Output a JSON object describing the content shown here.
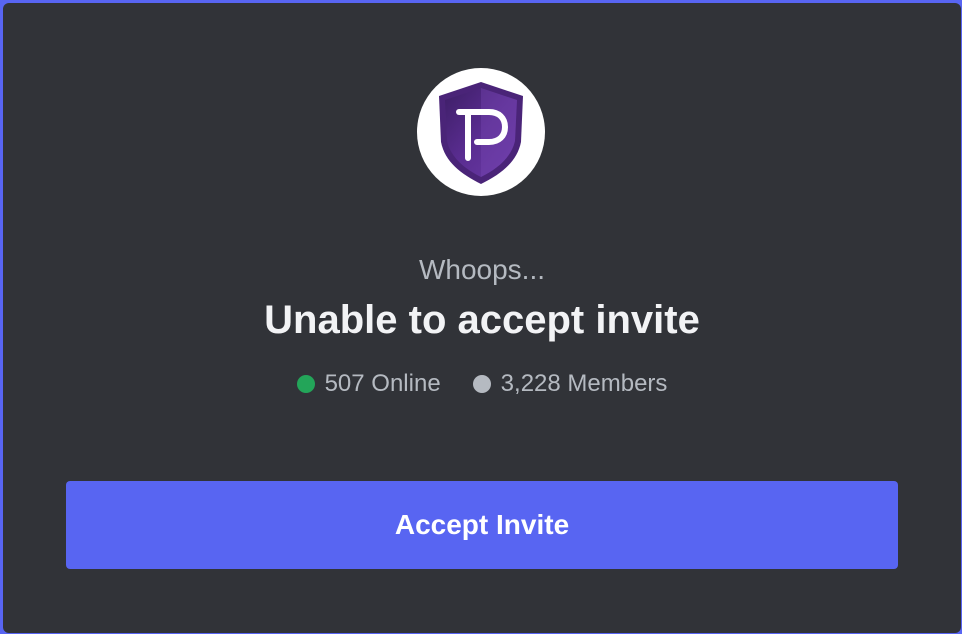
{
  "colors": {
    "background_accent": "#5865f2",
    "modal_bg": "#313338",
    "online": "#23a559",
    "members": "#b5bac1",
    "button": "#5865f2",
    "logo_purple": "#5b2e8f"
  },
  "server": {
    "icon": "pivx-shield-logo-icon"
  },
  "invite": {
    "subtitle": "Whoops...",
    "title": "Unable to accept invite",
    "online_count": "507 Online",
    "member_count": "3,228 Members"
  },
  "button": {
    "label": "Accept Invite"
  }
}
